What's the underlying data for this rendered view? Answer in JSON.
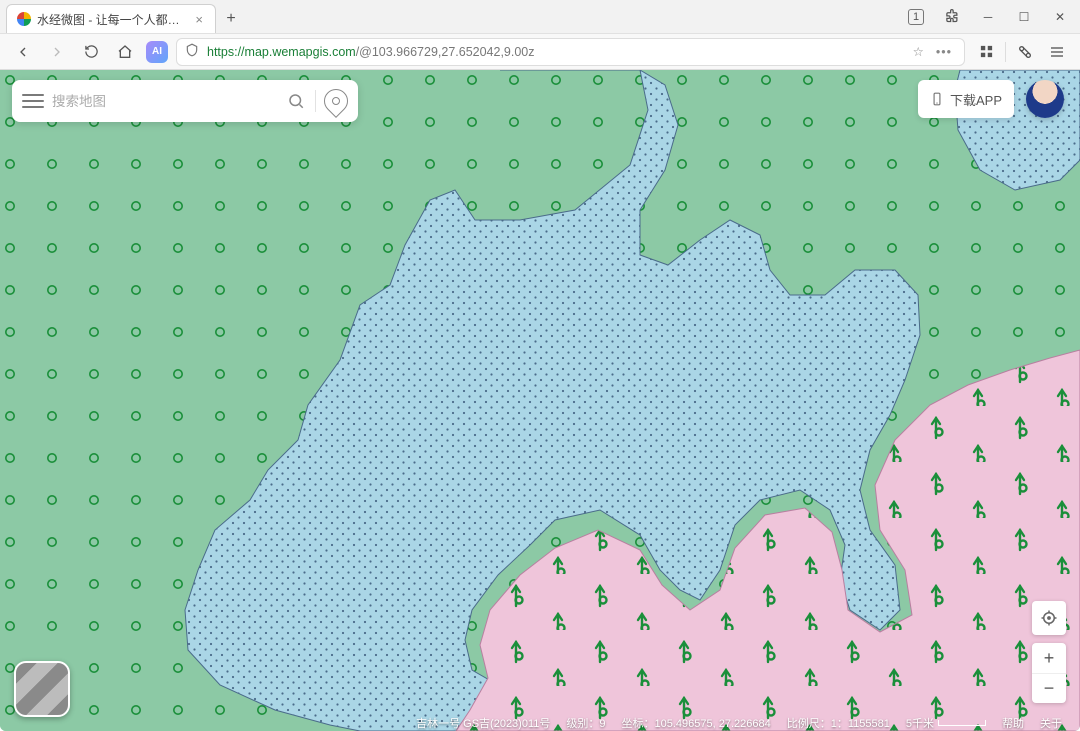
{
  "window": {
    "tab_title": "水经微图 - 让每一个人都有自",
    "badge_count": "1"
  },
  "browser": {
    "url_proto": "https://",
    "url_host": "map.wemapgis.com",
    "url_path": "/@103.966729,27.652042,9.00z"
  },
  "search": {
    "placeholder": "搜索地图"
  },
  "top_right": {
    "download_label": "下载APP"
  },
  "status": {
    "attribution": "吉林一号 GS吉(2023)011号",
    "level_label": "级别：",
    "level_value": "9",
    "coord_label": "坐标：",
    "coord_value": "105.496575, 27.226684",
    "scale_label": "比例尺：",
    "scale_value": "1：1155581",
    "scalebar_label": "5千米",
    "help_label": "帮助",
    "about_label": "关于"
  },
  "colors": {
    "region_green": "#8cc9a5",
    "region_blue": "#aad6e6",
    "region_pink": "#efc5da",
    "symbol_green": "#1a8f3a"
  }
}
